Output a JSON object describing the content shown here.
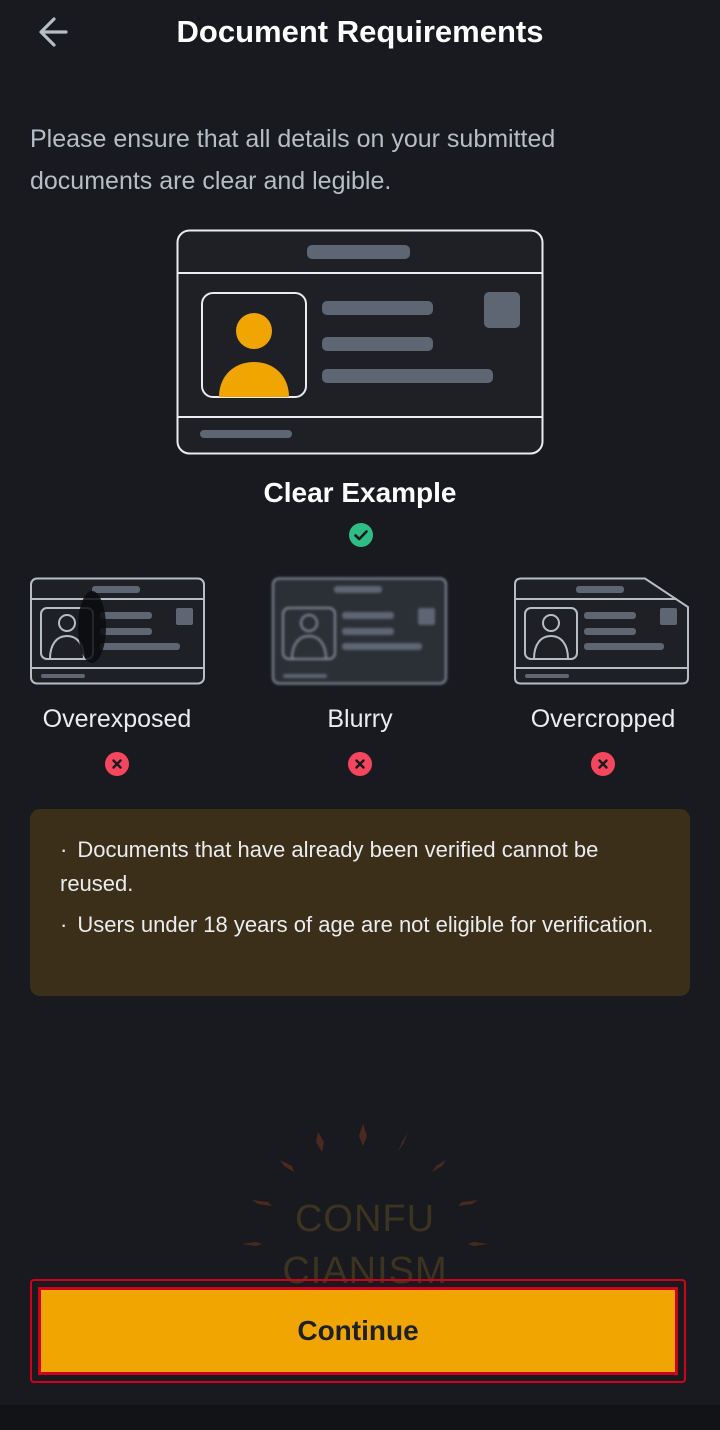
{
  "header": {
    "title": "Document Requirements",
    "back_icon": "arrow-left-icon"
  },
  "intro": "Please ensure that all details on your submitted documents are clear and legible.",
  "clear_example": {
    "label": "Clear Example",
    "status_icon": "check-circle-icon"
  },
  "bad_examples": [
    {
      "label": "Overexposed",
      "status_icon": "x-circle-icon"
    },
    {
      "label": "Blurry",
      "status_icon": "x-circle-icon"
    },
    {
      "label": "Overcropped",
      "status_icon": "x-circle-icon"
    }
  ],
  "notes": {
    "bullet": "·",
    "items": [
      "Documents that have already been verified cannot be reused.",
      "Users under 18 years of age are not eligible for verification."
    ]
  },
  "watermark": {
    "line1": "CONFU",
    "line2": "CIANISM"
  },
  "continue_label": "Continue",
  "colors": {
    "background": "#181a20",
    "accent": "#f0a500",
    "success": "#2ebd85",
    "error": "#f6465d",
    "note_bg": "#3c2f1a",
    "highlight_outline": "#d0021b"
  }
}
